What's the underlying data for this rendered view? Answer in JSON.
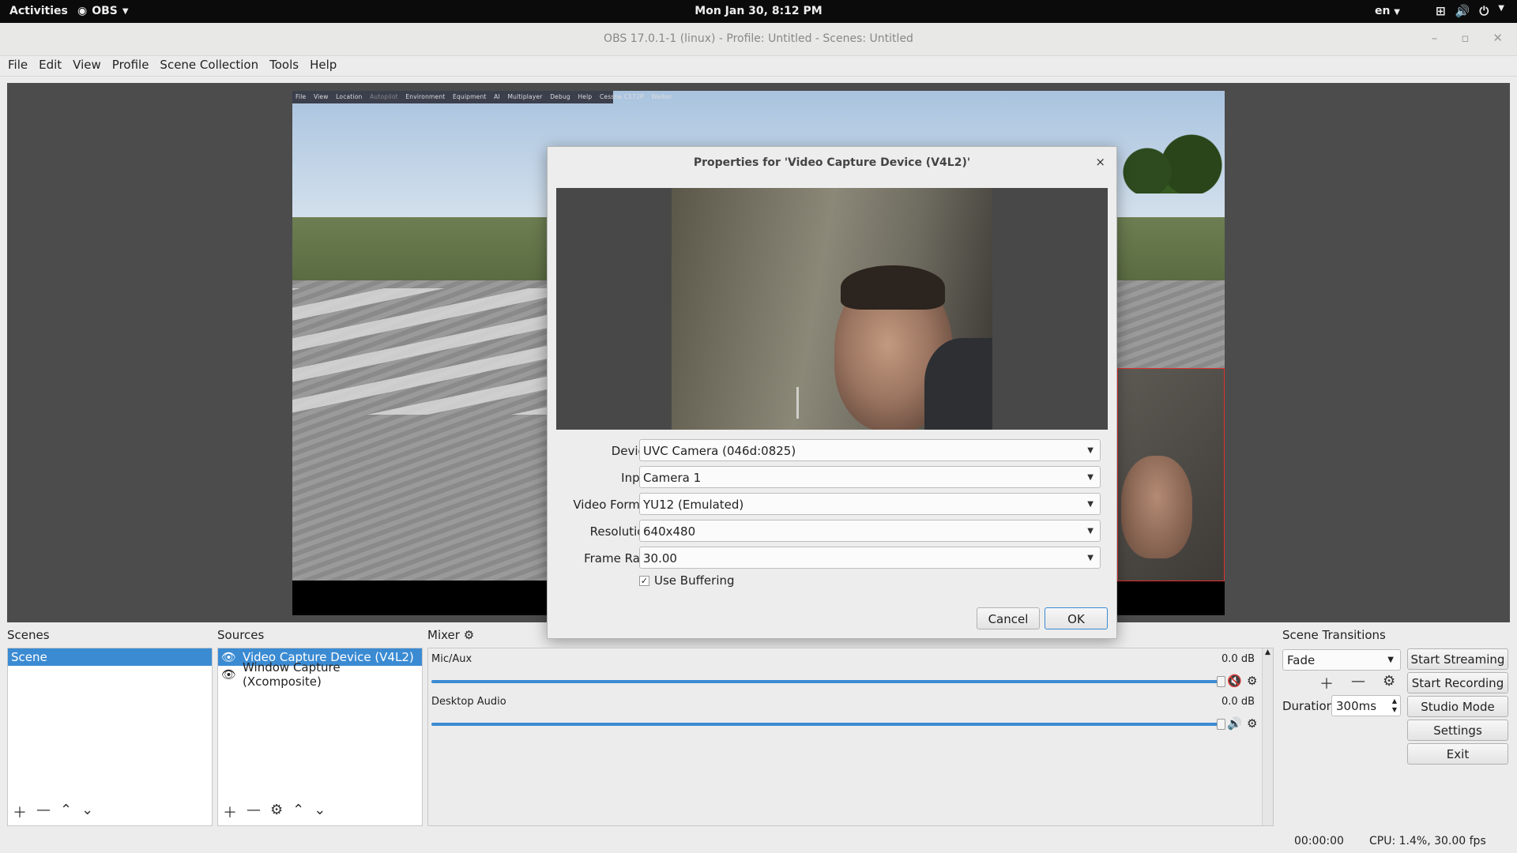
{
  "topbar": {
    "activities": "Activities",
    "app": "OBS",
    "clock": "Mon Jan 30,  8:12 PM",
    "lang": "en",
    "icons": [
      "network-icon",
      "volume-icon",
      "power-icon"
    ]
  },
  "window": {
    "title": "OBS 17.0.1-1 (linux) - Profile: Untitled - Scenes: Untitled",
    "buttons": [
      "minimize",
      "maximize",
      "close"
    ]
  },
  "menu": [
    "File",
    "Edit",
    "View",
    "Profile",
    "Scene Collection",
    "Tools",
    "Help"
  ],
  "sim_menu": [
    "File",
    "View",
    "Location",
    "Autopilot",
    "Environment",
    "Equipment",
    "AI",
    "Multiplayer",
    "Debug",
    "Help",
    "Cessna C172P",
    "Walker"
  ],
  "dialog": {
    "title": "Properties for 'Video Capture Device (V4L2)'",
    "close": "×",
    "fields": [
      {
        "label": "Device",
        "value": "UVC Camera (046d:0825)"
      },
      {
        "label": "Input",
        "value": "Camera 1"
      },
      {
        "label": "Video Format",
        "value": "YU12 (Emulated)"
      },
      {
        "label": "Resolution",
        "value": "640x480"
      },
      {
        "label": "Frame Rate",
        "value": "30.00"
      }
    ],
    "use_buffering": {
      "label": "Use Buffering",
      "checked": true
    },
    "cancel": "Cancel",
    "ok": "OK"
  },
  "scenes": {
    "label": "Scenes",
    "items": [
      "Scene"
    ]
  },
  "sources": {
    "label": "Sources",
    "items": [
      "Video Capture Device (V4L2)",
      "Window Capture (Xcomposite)"
    ]
  },
  "mixer": {
    "label": "Mixer",
    "tracks": [
      {
        "name": "Mic/Aux",
        "db": "0.0 dB",
        "muted": true
      },
      {
        "name": "Desktop Audio",
        "db": "0.0 dB",
        "muted": false
      }
    ]
  },
  "transitions": {
    "label": "Scene Transitions",
    "selected": "Fade",
    "duration_label": "Duration",
    "duration": "300ms"
  },
  "controls": [
    "Start Streaming",
    "Start Recording",
    "Studio Mode",
    "Settings",
    "Exit"
  ],
  "status": {
    "time": "00:00:00",
    "cpu": "CPU: 1.4%, 30.00 fps"
  },
  "colors": {
    "selection": "#3b8bd3",
    "muted": "#cc2222",
    "selection_box": "#e03030"
  }
}
